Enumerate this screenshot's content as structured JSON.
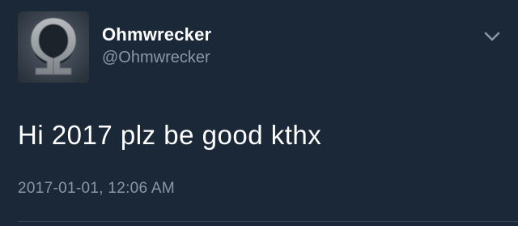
{
  "tweet": {
    "display_name": "Ohmwrecker",
    "handle": "@Ohmwrecker",
    "text": "Hi 2017 plz be good kthx",
    "timestamp": "2017-01-01, 12:06 AM",
    "avatar_icon": "omega-logo-icon",
    "menu_icon": "chevron-down-icon"
  },
  "colors": {
    "background": "#1b2837",
    "primary_text": "#ffffff",
    "secondary_text": "#8899a6",
    "divider": "#38444d"
  }
}
